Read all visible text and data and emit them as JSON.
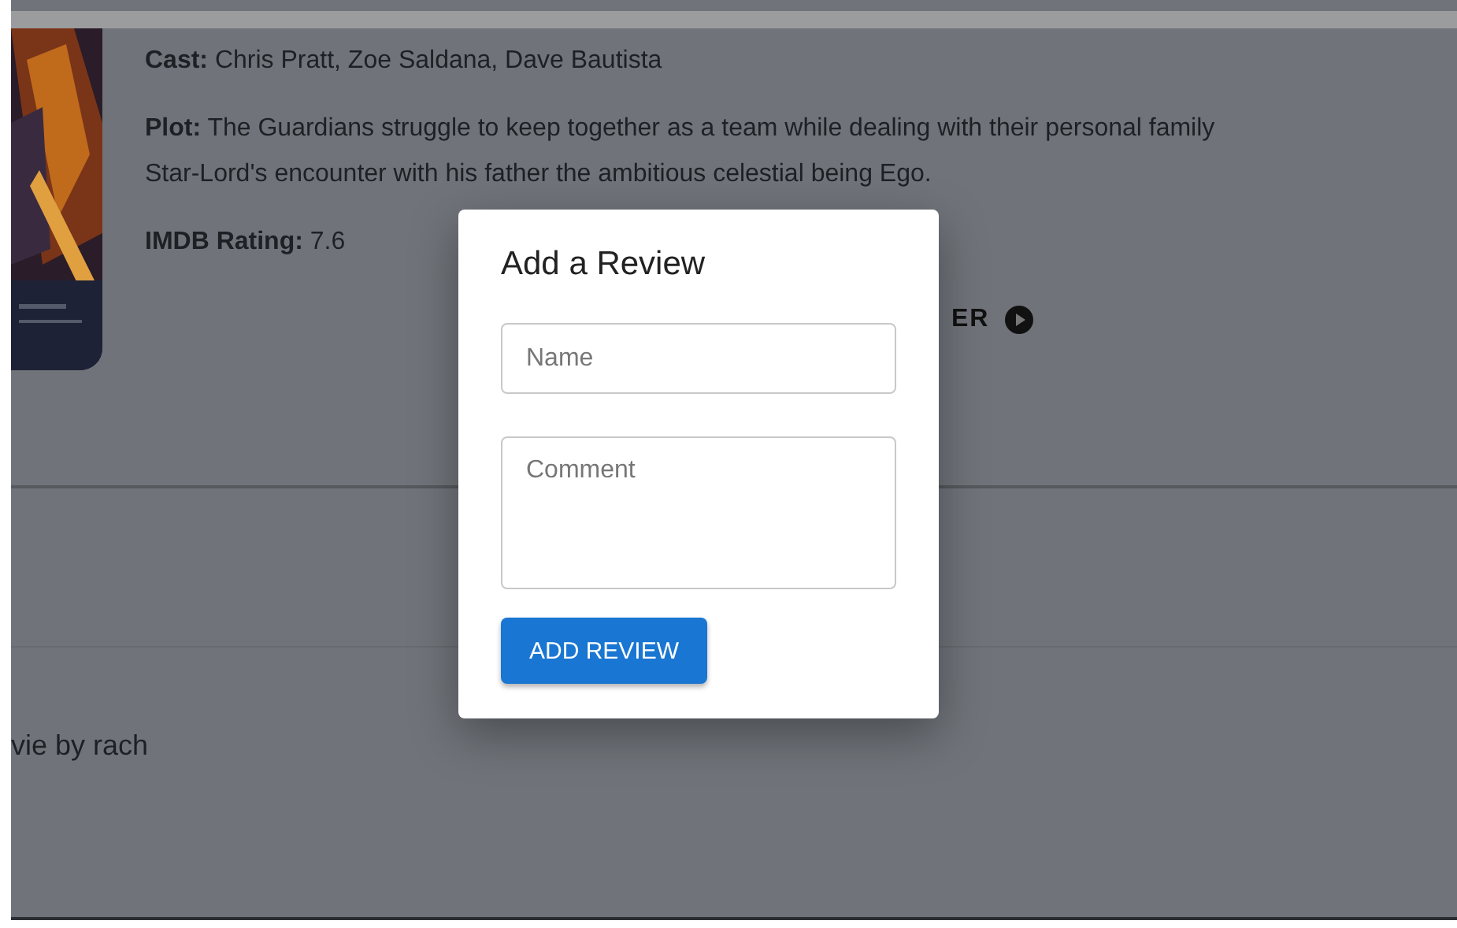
{
  "movie": {
    "cast": {
      "label": "Cast:",
      "value": "Chris Pratt, Zoe Saldana, Dave Bautista"
    },
    "plot": {
      "label": "Plot:",
      "lines": [
        "The Guardians struggle to keep together as a team while dealing with their personal family",
        "Star-Lord's encounter with his father the ambitious celestial being Ego."
      ]
    },
    "rating": {
      "label": "IMDB Rating:",
      "value": "7.6"
    },
    "trailer_link": "ER"
  },
  "reviews": [
    {
      "text": "vie by rach"
    }
  ],
  "dialog": {
    "title": "Add a Review",
    "name_field": {
      "placeholder": "Name"
    },
    "comment_field": {
      "placeholder": "Comment"
    },
    "submit_button": "ADD REVIEW"
  }
}
